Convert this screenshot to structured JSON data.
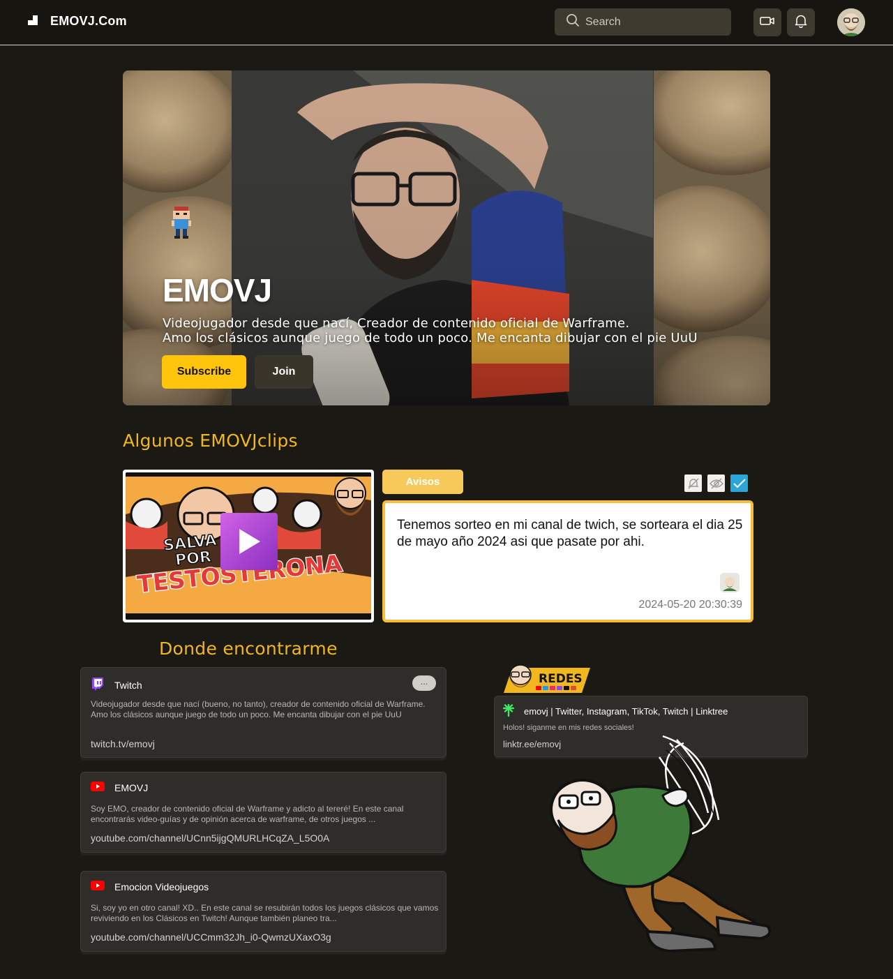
{
  "header": {
    "brand": "EMOVJ.Com",
    "search_placeholder": "Search"
  },
  "hero": {
    "name": "EMOVJ",
    "description": "Videojugador desde que nací, Creador de contenido oficial de Warframe.\n Amo los clásicos aunque juego de todo un poco. Me encanta dibujar con el pie UuU",
    "subscribe_label": "Subscribe",
    "join_label": "Join"
  },
  "clips": {
    "title": "Algunos EMOVJclips",
    "thumbnail_text_top": "SALVA",
    "thumbnail_text_mid": "POR",
    "thumbnail_text_big": "TESTOSTERONA"
  },
  "avisos": {
    "tab_label": "Avisos",
    "message": "Tenemos sorteo en mi canal de twich, se sorteara el dia 25 de mayo año 2024 asi que pasate por ahi.",
    "timestamp": "2024-05-20 20:30:39"
  },
  "links": {
    "title": "Donde encontrarme",
    "items": [
      {
        "platform": "Twitch",
        "icon": "twitch-icon",
        "description": "Videojugador desde que nací (bueno, no tanto), creador de contenido oficial de Warframe. Amo los clásicos aunque juego de todo un poco. Me encanta dibujar con el pie UuU",
        "url": "twitch.tv/emovj",
        "more_label": "..."
      },
      {
        "platform": "EMOVJ",
        "icon": "youtube-icon",
        "description": "Soy EMO, creador de contenido oficial de Warframe y adicto al tereré! En este canal encontrarás video-guías y de opinión acerca de warframe, de otros juegos ...",
        "url": "youtube.com/channel/UCnn5ijgQMURLHCqZA_L5O0A"
      },
      {
        "platform": "Emocion Videojuegos",
        "icon": "youtube-icon",
        "description": "Si, soy yo en otro canal! XD.. En este canal se resubirán todos los juegos clásicos que vamos reviviendo en los Clásicos en Twitch! Aunque también planeo tra...",
        "url": "youtube.com/channel/UCCmm32Jh_i0-QwmzUXaxO3g"
      }
    ]
  },
  "redes": {
    "banner_label": "REDES",
    "title": "emovj | Twitter, Instagram, TikTok, Twitch | Linktree",
    "description": "Holos! siganme en mis redes sociales!",
    "url": "linktr.ee/emovj"
  },
  "colors": {
    "background": "#1b1913",
    "accent_yellow": "#ffc50c",
    "section_title": "#f2b61e",
    "twitch_purple": "#9146ff",
    "youtube_red": "#ff0000"
  }
}
